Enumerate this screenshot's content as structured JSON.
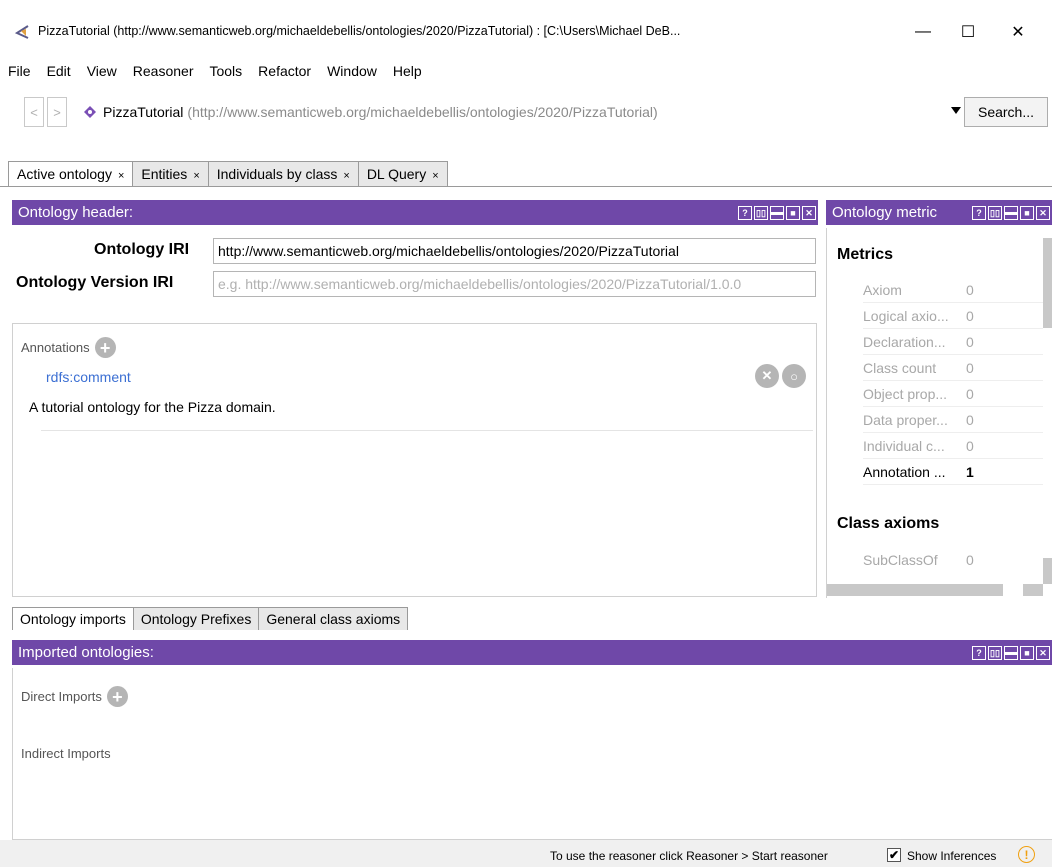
{
  "window": {
    "title": "PizzaTutorial (http://www.semanticweb.org/michaeldebellis/ontologies/2020/PizzaTutorial)  : [C:\\Users\\Michael DeB...",
    "minimize": "—",
    "maximize": "☐",
    "close": "✕"
  },
  "menu": [
    "File",
    "Edit",
    "View",
    "Reasoner",
    "Tools",
    "Refactor",
    "Window",
    "Help"
  ],
  "nav": {
    "back": "<",
    "forward": ">",
    "ontology_name": "PizzaTutorial",
    "ontology_iri": "(http://www.semanticweb.org/michaeldebellis/ontologies/2020/PizzaTutorial)",
    "search_label": "Search..."
  },
  "workspace_tabs": [
    {
      "label": "Active ontology",
      "close": "×"
    },
    {
      "label": "Entities",
      "close": "×"
    },
    {
      "label": "Individuals by class",
      "close": "×"
    },
    {
      "label": "DL Query",
      "close": "×"
    }
  ],
  "header_view": {
    "title": "Ontology header:",
    "iri_label": "Ontology IRI",
    "iri_value": "http://www.semanticweb.org/michaeldebellis/ontologies/2020/PizzaTutorial",
    "version_label": "Ontology Version IRI",
    "version_placeholder": "e.g. http://www.semanticweb.org/michaeldebellis/ontologies/2020/PizzaTutorial/1.0.0",
    "annotations_label": "Annotations",
    "annotation_property": "rdfs:comment",
    "annotation_value": "A tutorial ontology for the Pizza domain."
  },
  "metrics_view": {
    "title": "Ontology metric",
    "metrics_heading": "Metrics",
    "metrics": [
      {
        "name": "Axiom",
        "value": "0"
      },
      {
        "name": "Logical axio...",
        "value": "0"
      },
      {
        "name": "Declaration...",
        "value": "0"
      },
      {
        "name": "Class count",
        "value": "0"
      },
      {
        "name": "Object prop...",
        "value": "0"
      },
      {
        "name": "Data proper...",
        "value": "0"
      },
      {
        "name": "Individual c...",
        "value": "0"
      },
      {
        "name": "Annotation ...",
        "value": "1"
      }
    ],
    "class_axioms_heading": "Class axioms",
    "class_axioms": [
      {
        "name": "SubClassOf",
        "value": "0"
      }
    ]
  },
  "lower_tabs": [
    "Ontology imports",
    "Ontology Prefixes",
    "General class axioms"
  ],
  "imports_view": {
    "title": "Imported ontologies:",
    "direct_label": "Direct Imports",
    "indirect_label": "Indirect Imports"
  },
  "status": {
    "message": "To use the reasoner click Reasoner > Start reasoner",
    "checkbox_mark": "✔",
    "show_inferences": "Show Inferences",
    "warning": "!"
  },
  "colors": {
    "view_header": "#6f48a8",
    "link": "#3b6fd3"
  }
}
